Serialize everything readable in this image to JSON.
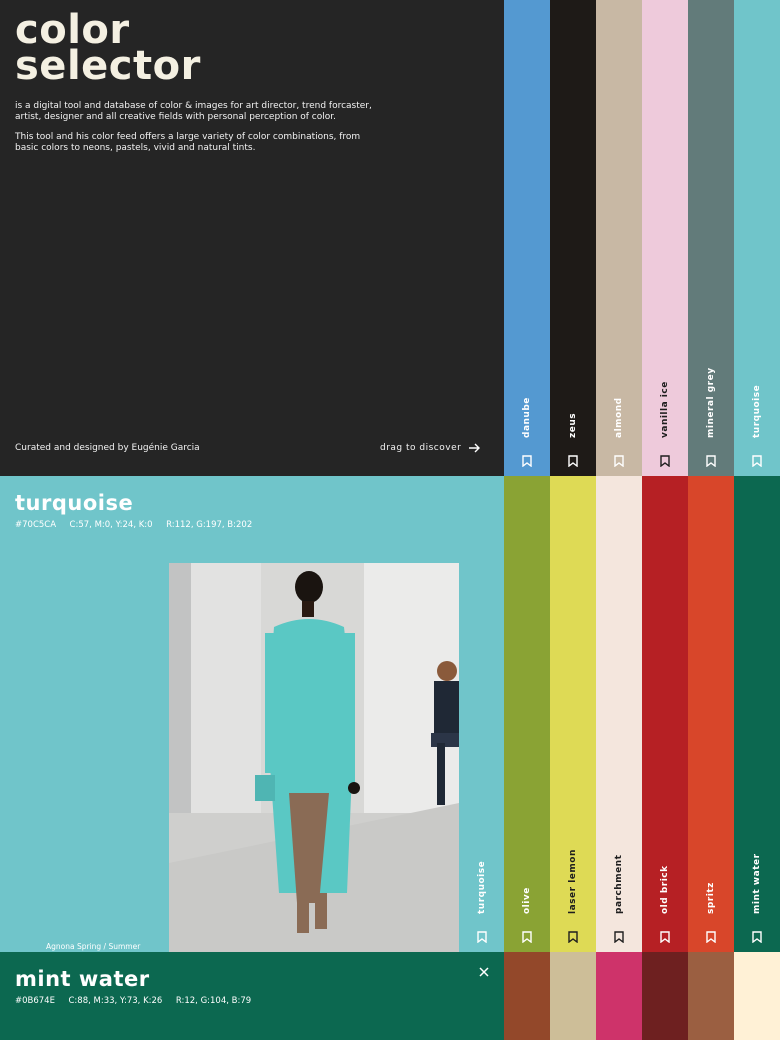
{
  "hero": {
    "title_line1": "color",
    "title_line2": "selector",
    "desc1": "is a digital tool and database of color & images for art director, trend forcaster, artist, designer and all creative fields with personal perception of color.",
    "desc2": "This tool and his color feed offers a large variety of color combinations, from basic colors to neons, pastels, vivid and natural tints.",
    "credit": "Curated and designed by Eugénie Garcia",
    "drag_label": "drag to discover"
  },
  "strips_row1": [
    {
      "name": "danube",
      "color": "#5499D1",
      "text": "#ffffff"
    },
    {
      "name": "zeus",
      "color": "#1E1A17",
      "text": "#ffffff"
    },
    {
      "name": "almond",
      "color": "#C8B8A4",
      "text": "#ffffff"
    },
    {
      "name": "vanilla ice",
      "color": "#EECADB",
      "text": "#1e1e1e"
    },
    {
      "name": "mineral grey",
      "color": "#627B7A",
      "text": "#ffffff"
    },
    {
      "name": "turquoise",
      "color": "#70C5CA",
      "text": "#ffffff"
    }
  ],
  "strips_row2": [
    {
      "name": "olive",
      "color": "#8AA334",
      "text": "#ffffff"
    },
    {
      "name": "laser lemon",
      "color": "#DEDA55",
      "text": "#1e1e1e"
    },
    {
      "name": "parchment",
      "color": "#F4E6DD",
      "text": "#1e1e1e"
    },
    {
      "name": "old brick",
      "color": "#B62024",
      "text": "#ffffff"
    },
    {
      "name": "spritz",
      "color": "#D8462A",
      "text": "#ffffff"
    },
    {
      "name": "mint water",
      "color": "#0C6850",
      "text": "#ffffff"
    }
  ],
  "strips_row3": [
    {
      "color": "#93482A"
    },
    {
      "color": "#CDBE98"
    },
    {
      "color": "#CE336A"
    },
    {
      "color": "#6E2020"
    },
    {
      "color": "#9B5F41"
    },
    {
      "color": "#FFF1D6"
    }
  ],
  "panel_turquoise": {
    "title": "turquoise",
    "hex": "#70C5CA",
    "cmyk": "C:57, M:0, Y:24, K:0",
    "rgb": "R:112, G:197, B:202",
    "color": "#70C5CA",
    "side_label": "turquoise",
    "caption": "Agnona Spring / Summer"
  },
  "panel_mint": {
    "title": "mint water",
    "hex": "#0B674E",
    "cmyk": "C:88, M:33, Y:73, K:26",
    "rgb": "R:12, G:104, B:79",
    "color": "#0C6850"
  },
  "icons": {
    "arrow": "arrow-right-icon",
    "bookmark": "bookmark-icon",
    "close": "close-icon"
  }
}
